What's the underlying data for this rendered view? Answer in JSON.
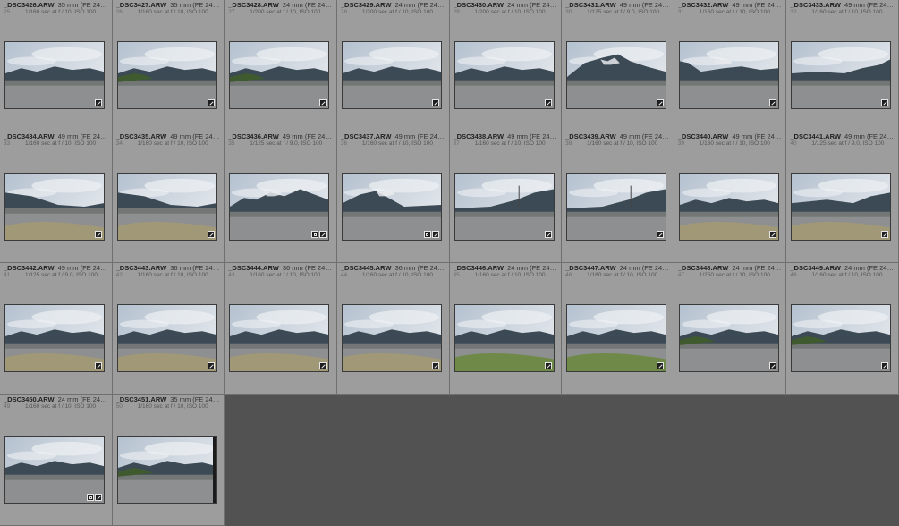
{
  "photos": [
    {
      "index": "25",
      "filename": "_DSC3426.ARW",
      "lens": "35 mm (FE 24-105m...",
      "exposure": "1/160 sec at f / 10, ISO 100",
      "scene": "flat_wide",
      "badges": [
        "edit"
      ]
    },
    {
      "index": "26",
      "filename": "_DSC3427.ARW",
      "lens": "35 mm (FE 24-105m...",
      "exposure": "1/160 sec at f / 10, ISO 100",
      "scene": "blue_left",
      "badges": [
        "edit"
      ]
    },
    {
      "index": "27",
      "filename": "_DSC3428.ARW",
      "lens": "24 mm (FE 24-105m...",
      "exposure": "1/200 sec at f / 10, ISO 100",
      "scene": "blue_left",
      "badges": [
        "edit"
      ]
    },
    {
      "index": "28",
      "filename": "_DSC3429.ARW",
      "lens": "24 mm (FE 24-105m...",
      "exposure": "1/200 sec at f / 10, ISO 100",
      "scene": "cloudy_flat",
      "badges": [
        "edit"
      ]
    },
    {
      "index": "29",
      "filename": "_DSC3430.ARW",
      "lens": "24 mm (FE 24-105m...",
      "exposure": "1/200 sec at f / 10, ISO 100",
      "scene": "cloudy_flat",
      "badges": [
        "edit"
      ]
    },
    {
      "index": "30",
      "filename": "_DSC3431.ARW",
      "lens": "49 mm (FE 24-105m...",
      "exposure": "1/125 sec at f / 9.0, ISO 100",
      "scene": "peak_center",
      "badges": [
        "edit"
      ]
    },
    {
      "index": "31",
      "filename": "_DSC3432.ARW",
      "lens": "49 mm (FE 24-105m...",
      "exposure": "1/160 sec at f / 10, ISO 100",
      "scene": "peak_left",
      "badges": [
        "edit"
      ]
    },
    {
      "index": "32",
      "filename": "_DSC3433.ARW",
      "lens": "49 mm (FE 24-105m...",
      "exposure": "1/160 sec at f / 10, ISO 100",
      "scene": "ridge_right",
      "badges": [
        "edit"
      ]
    },
    {
      "index": "33",
      "filename": "_DSC3434.ARW",
      "lens": "49 mm (FE 24-105m...",
      "exposure": "1/160 sec at f / 10, ISO 100",
      "scene": "grass_slope",
      "badges": [
        "edit"
      ]
    },
    {
      "index": "34",
      "filename": "_DSC3435.ARW",
      "lens": "49 mm (FE 24-105m...",
      "exposure": "1/160 sec at f / 10, ISO 100",
      "scene": "grass_slope",
      "badges": [
        "edit"
      ]
    },
    {
      "index": "35",
      "filename": "_DSC3436.ARW",
      "lens": "49 mm (FE 24-105m...",
      "exposure": "1/125 sec at f / 9.0, ISO 100",
      "scene": "snow_range",
      "badges": [
        "crop",
        "edit"
      ]
    },
    {
      "index": "36",
      "filename": "_DSC3437.ARW",
      "lens": "49 mm (FE 24-105m...",
      "exposure": "1/160 sec at f / 10, ISO 100",
      "scene": "snow_peak_left",
      "badges": [
        "crop",
        "edit"
      ]
    },
    {
      "index": "37",
      "filename": "_DSC3438.ARW",
      "lens": "49 mm (FE 24-105m...",
      "exposure": "1/160 sec at f / 10, ISO 100",
      "scene": "pylon_ridge",
      "badges": [
        "edit"
      ]
    },
    {
      "index": "38",
      "filename": "_DSC3439.ARW",
      "lens": "49 mm (FE 24-105m...",
      "exposure": "1/160 sec at f / 10, ISO 100",
      "scene": "pylon_ridge",
      "badges": [
        "edit"
      ]
    },
    {
      "index": "39",
      "filename": "_DSC3440.ARW",
      "lens": "49 mm (FE 24-105m...",
      "exposure": "1/160 sec at f / 10, ISO 100",
      "scene": "grass_field",
      "badges": [
        "edit"
      ]
    },
    {
      "index": "40",
      "filename": "_DSC3441.ARW",
      "lens": "49 mm (FE 24-105m...",
      "exposure": "1/125 sec at f / 9.0, ISO 100",
      "scene": "grass_field_right",
      "badges": [
        "edit"
      ]
    },
    {
      "index": "41",
      "filename": "_DSC3442.ARW",
      "lens": "49 mm (FE 24-105m...",
      "exposure": "1/125 sec at f / 9.0, ISO 100",
      "scene": "grass_field",
      "badges": [
        "edit"
      ]
    },
    {
      "index": "42",
      "filename": "_DSC3443.ARW",
      "lens": "36 mm (FE 24-105m...",
      "exposure": "1/160 sec at f / 10, ISO 100",
      "scene": "grass_field",
      "badges": [
        "edit"
      ]
    },
    {
      "index": "43",
      "filename": "_DSC3444.ARW",
      "lens": "36 mm (FE 24-105m...",
      "exposure": "1/160 sec at f / 10, ISO 100",
      "scene": "grass_field",
      "badges": [
        "edit"
      ]
    },
    {
      "index": "44",
      "filename": "_DSC3445.ARW",
      "lens": "36 mm (FE 24-105m...",
      "exposure": "1/160 sec at f / 10, ISO 100",
      "scene": "grass_field",
      "badges": [
        "edit"
      ]
    },
    {
      "index": "45",
      "filename": "_DSC3446.ARW",
      "lens": "24 mm (FE 24-105m...",
      "exposure": "1/160 sec at f / 10, ISO 100",
      "scene": "green_field",
      "badges": [
        "edit"
      ]
    },
    {
      "index": "46",
      "filename": "_DSC3447.ARW",
      "lens": "24 mm (FE 24-105m...",
      "exposure": "1/160 sec at f / 10, ISO 100",
      "scene": "green_field",
      "badges": [
        "edit"
      ]
    },
    {
      "index": "47",
      "filename": "_DSC3448.ARW",
      "lens": "24 mm (FE 24-105m...",
      "exposure": "1/250 sec at f / 10, ISO 100",
      "scene": "blue_left",
      "badges": [
        "edit"
      ]
    },
    {
      "index": "48",
      "filename": "_DSC3449.ARW",
      "lens": "24 mm (FE 24-105m...",
      "exposure": "1/160 sec at f / 10, ISO 100",
      "scene": "blue_left",
      "badges": [
        "edit"
      ]
    },
    {
      "index": "49",
      "filename": "_DSC3450.ARW",
      "lens": "24 mm (FE 24-105m...",
      "exposure": "1/160 sec at f / 10, ISO 100",
      "scene": "flat_wide",
      "badges": [
        "crop",
        "edit"
      ]
    },
    {
      "index": "50",
      "filename": "_DSC3451.ARW",
      "lens": "35 mm (FE 24-105m...",
      "exposure": "1/160 sec at f / 10, ISO 100",
      "scene": "blue_left_strip",
      "badges": []
    }
  ]
}
